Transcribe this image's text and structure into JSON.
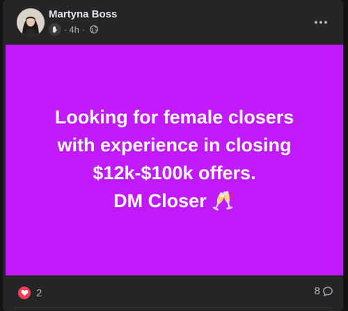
{
  "post": {
    "author": "Martyna Boss",
    "time": "4h",
    "separator": "·",
    "privacy_icon": "globe-icon",
    "author_badge_icon": "wave-icon",
    "background_color": "#c11aff",
    "text_lines": [
      "Looking for female closers",
      "with experience in closing",
      "$12k-$100k offers.",
      "DM Closer 🥂"
    ]
  },
  "footer": {
    "reaction_icon": "heart-icon",
    "reaction_count": "2",
    "comment_count": "8",
    "comment_icon": "comment-icon"
  }
}
